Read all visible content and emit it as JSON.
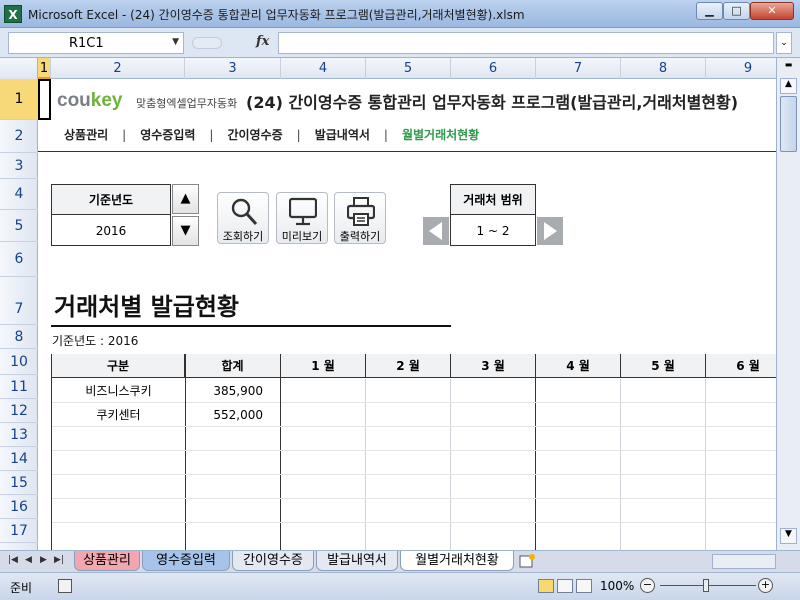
{
  "window": {
    "title": "Microsoft Excel - (24) 간이영수증 통합관리 업무자동화 프로그램(발급관리,거래처별현황).xlsm",
    "min_icon": "minimize-icon",
    "max_icon": "maximize-icon",
    "close_icon": "close-icon"
  },
  "formula_bar": {
    "name_box": "R1C1",
    "fx": "fx",
    "formula": ""
  },
  "columns": [
    "1",
    "2",
    "3",
    "4",
    "5",
    "6",
    "7",
    "8",
    "9"
  ],
  "rows": [
    "1",
    "2",
    "3",
    "4",
    "5",
    "6",
    "7",
    "8",
    "10",
    "11",
    "12",
    "13",
    "14",
    "15",
    "16",
    "17"
  ],
  "header": {
    "logo_main": "cou",
    "logo_accent": "key",
    "logo_sub": "맞춤형엑셀업무자동화",
    "program_title": "(24) 간이영수증 통합관리 업무자동화 프로그램(발급관리,거래처별현황)"
  },
  "nav": {
    "items": [
      {
        "label": "상품관리"
      },
      {
        "label": "영수증입력"
      },
      {
        "label": "간이영수증"
      },
      {
        "label": "발급내역서"
      },
      {
        "label": "월별거래처현황"
      }
    ],
    "separator": "|",
    "active_color": "#2e9b4b"
  },
  "controls": {
    "year_label": "기준년도",
    "year_value": "2016",
    "search_label": "조회하기",
    "preview_label": "미리보기",
    "print_label": "출력하기",
    "range_label": "거래처 범위",
    "range_value": "1 ~ 2"
  },
  "report": {
    "title": "거래처별 발급현황",
    "base_year": "기준년도 : 2016"
  },
  "table": {
    "headers": [
      "구분",
      "합계",
      "1 월",
      "2 월",
      "3 월",
      "4 월",
      "5 월",
      "6 월"
    ],
    "rows": [
      {
        "name": "비즈니스쿠키",
        "total": "385,900"
      },
      {
        "name": "쿠키센터",
        "total": "552,000"
      }
    ]
  },
  "tabs": [
    "상품관리",
    "영수증입력",
    "간이영수증",
    "발급내역서",
    "월별거래처현황"
  ],
  "status": {
    "ready": "준비",
    "zoom": "100%"
  },
  "colors": {
    "accent_green": "#6fb33b",
    "tab_pink": "#f1a6b0",
    "tab_blue": "#a6c3ec"
  }
}
